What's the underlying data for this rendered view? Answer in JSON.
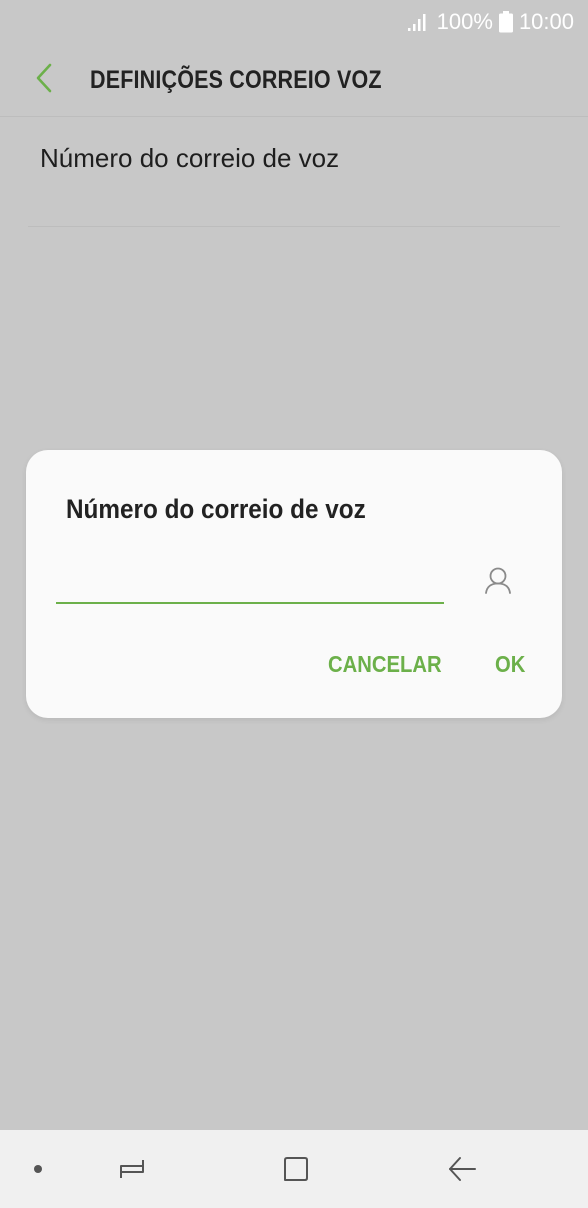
{
  "status_bar": {
    "battery_text": "100%",
    "time": "10:00",
    "icons": [
      "signal-icon",
      "battery-icon"
    ]
  },
  "header": {
    "title": "DEFINIÇÕES CORREIO VOZ",
    "back_icon": "chevron-left-icon"
  },
  "settings": {
    "items": [
      {
        "label": "Número do correio de voz"
      }
    ]
  },
  "dialog": {
    "title": "Número do correio de voz",
    "input_value": "",
    "contact_icon": "contact-icon",
    "cancel_label": "CANCELAR",
    "ok_label": "OK"
  },
  "nav_bar": {
    "icons": [
      "dot-icon",
      "recent-apps-icon",
      "home-icon",
      "back-arrow-icon"
    ]
  },
  "colors": {
    "accent": "#6cb04a",
    "background": "#c8c8c8",
    "dialog_bg": "#fafafa",
    "nav_bg": "#f0f0f0"
  }
}
